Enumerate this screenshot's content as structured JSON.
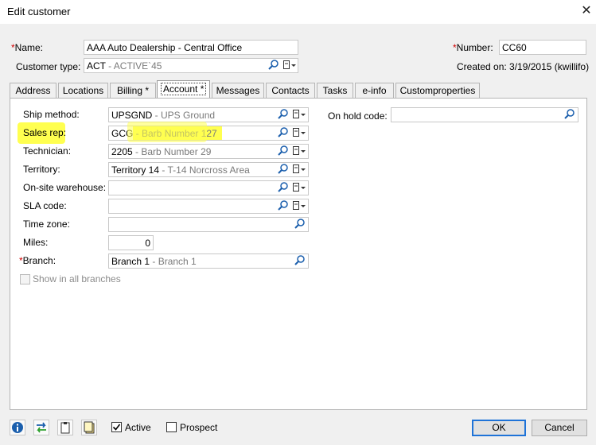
{
  "window": {
    "title": "Edit customer"
  },
  "header": {
    "name_label": "Name:",
    "name_value": "AAA Auto Dealership - Central Office",
    "customer_type_label": "Customer type:",
    "customer_type_code": "ACT",
    "customer_type_desc": " - ACTIVE`45",
    "number_label": "Number:",
    "number_value": "CC60",
    "created_on": "Created on: 3/19/2015 (kwillifo)"
  },
  "tabs": [
    "Address",
    "Locations",
    "Billing *",
    "Account *",
    "Messages",
    "Contacts",
    "Tasks",
    "e-info",
    "Customproperties"
  ],
  "account": {
    "ship_method": {
      "label": "Ship method:",
      "code": "UPSGND",
      "desc": " - UPS Ground"
    },
    "sales_rep": {
      "label": "Sales rep:",
      "code": "GCG",
      "desc": " - Barb Number 127"
    },
    "technician": {
      "label": "Technician:",
      "code": "2205",
      "desc": " - Barb Number 29"
    },
    "territory": {
      "label": "Territory:",
      "code": "Territory 14",
      "desc": " - T-14 Norcross Area"
    },
    "onsite_warehouse": {
      "label": "On-site warehouse:"
    },
    "sla_code": {
      "label": "SLA code:"
    },
    "time_zone": {
      "label": "Time zone:"
    },
    "miles": {
      "label": "Miles:",
      "value": "0"
    },
    "branch": {
      "label": "Branch:",
      "code": "Branch 1",
      "desc": " - Branch 1"
    },
    "show_all_branches": "Show in all branches",
    "on_hold_label": "On hold code:"
  },
  "footer": {
    "active_label": "Active",
    "prospect_label": "Prospect",
    "ok_label": "OK",
    "cancel_label": "Cancel"
  },
  "colors": {
    "highlight": "#ffff50",
    "required": "#d00000",
    "ok_border": "#1e73d8"
  }
}
